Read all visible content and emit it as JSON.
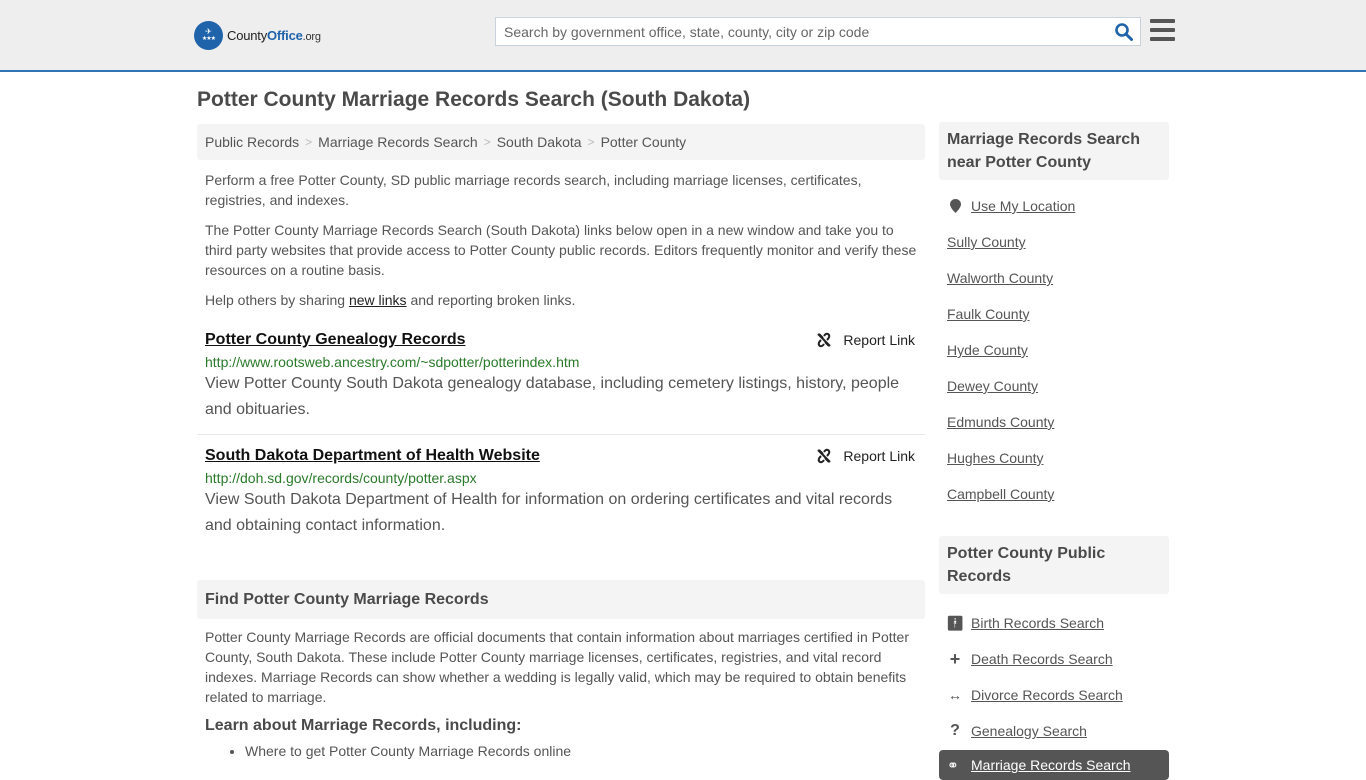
{
  "header": {
    "logo": {
      "name_part1": "County",
      "name_part2": "Office",
      "name_part3": ".org"
    },
    "search": {
      "placeholder": "Search by government office, state, county, city or zip code",
      "value": ""
    },
    "colors": {
      "brand": "#1f63aa",
      "accent_line": "#2f74b5"
    }
  },
  "page": {
    "title": "Potter County Marriage Records Search (South Dakota)"
  },
  "breadcrumb": [
    {
      "label": "Public Records"
    },
    {
      "label": "Marriage Records Search"
    },
    {
      "label": "South Dakota"
    },
    {
      "label": "Potter County"
    }
  ],
  "intro": {
    "p1": "Perform a free Potter County, SD public marriage records search, including marriage licenses, certificates, registries, and indexes.",
    "p2": "The Potter County Marriage Records Search (South Dakota) links below open in a new window and take you to third party websites that provide access to Potter County public records. Editors frequently monitor and verify these resources on a routine basis.",
    "p3_before": "Help others by sharing ",
    "p3_link": "new links",
    "p3_after": " and reporting broken links."
  },
  "links": [
    {
      "title": "Potter County Genealogy Records",
      "url": "http://www.rootsweb.ancestry.com/~sdpotter/potterindex.htm",
      "description": "View Potter County South Dakota genealogy database, including cemetery listings, history, people and obituaries.",
      "report_label": "Report Link"
    },
    {
      "title": "South Dakota Department of Health Website",
      "url": "http://doh.sd.gov/records/county/potter.aspx",
      "description": "View South Dakota Department of Health for information on ordering certificates and vital records and obtaining contact information.",
      "report_label": "Report Link"
    }
  ],
  "find": {
    "heading": "Find Potter County Marriage Records",
    "paragraph": "Potter County Marriage Records are official documents that contain information about marriages certified in Potter County, South Dakota. These include Potter County marriage licenses, certificates, registries, and vital record indexes. Marriage Records can show whether a wedding is legally valid, which may be required to obtain benefits related to marriage.",
    "subheading": "Learn about Marriage Records, including:",
    "bullets": [
      "Where to get Potter County Marriage Records online"
    ]
  },
  "sidebar_nearby": {
    "heading": "Marriage Records Search near Potter County",
    "use_location": "Use My Location",
    "counties": [
      "Sully County",
      "Walworth County",
      "Faulk County",
      "Hyde County",
      "Dewey County",
      "Edmunds County",
      "Hughes County",
      "Campbell County"
    ]
  },
  "sidebar_public": {
    "heading": "Potter County Public Records",
    "items": [
      {
        "label": "Birth Records Search",
        "icon": "child-icon"
      },
      {
        "label": "Death Records Search",
        "icon": "plus-icon"
      },
      {
        "label": "Divorce Records Search",
        "icon": "arrows-horizontal-icon"
      },
      {
        "label": "Genealogy Search",
        "icon": "question-icon"
      }
    ],
    "active": {
      "label": "Marriage Records Search",
      "icon": "marriage-icon"
    }
  }
}
